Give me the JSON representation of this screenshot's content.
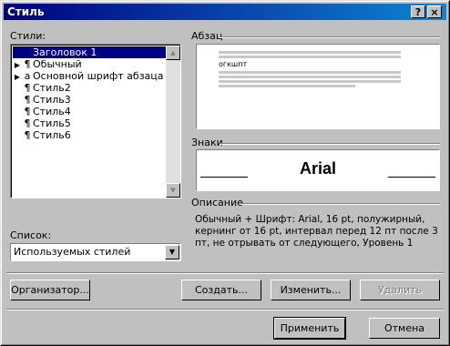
{
  "window": {
    "title": "Стиль",
    "help_label": "?",
    "close_label": "×"
  },
  "styles_label": "Стили:",
  "styles_list": [
    {
      "marker": "",
      "symbol": "",
      "label": "Заголовок 1",
      "selected": true
    },
    {
      "marker": "▶",
      "symbol": "¶",
      "label": "Обычный",
      "selected": false
    },
    {
      "marker": "▶",
      "symbol": "a",
      "label": "Основной шрифт абзаца",
      "selected": false
    },
    {
      "marker": "",
      "symbol": "¶",
      "label": "Стиль2",
      "selected": false
    },
    {
      "marker": "",
      "symbol": "¶",
      "label": "Стиль3",
      "selected": false
    },
    {
      "marker": "",
      "symbol": "¶",
      "label": "Стиль4",
      "selected": false
    },
    {
      "marker": "",
      "symbol": "¶",
      "label": "Стиль5",
      "selected": false
    },
    {
      "marker": "",
      "symbol": "¶",
      "label": "Стиль6",
      "selected": false
    }
  ],
  "paragraph": {
    "label": "Абзац",
    "sample_text": "огкшпт"
  },
  "chars": {
    "label": "Знаки",
    "sample_font": "Arial"
  },
  "description": {
    "label": "Описание",
    "text": "Обычный + Шрифт: Arial, 16 pt, полужирный, кернинг от 16 pt, интервал перед 12 пт  после 3 пт, не отрывать от следующего, Уровень 1"
  },
  "list_filter": {
    "label": "Список:",
    "value": "Используемых стилей"
  },
  "buttons": {
    "organizer": "Организатор...",
    "create": "Создать...",
    "modify": "Изменить...",
    "delete": "Удалить",
    "apply": "Применить",
    "cancel": "Отмена"
  }
}
